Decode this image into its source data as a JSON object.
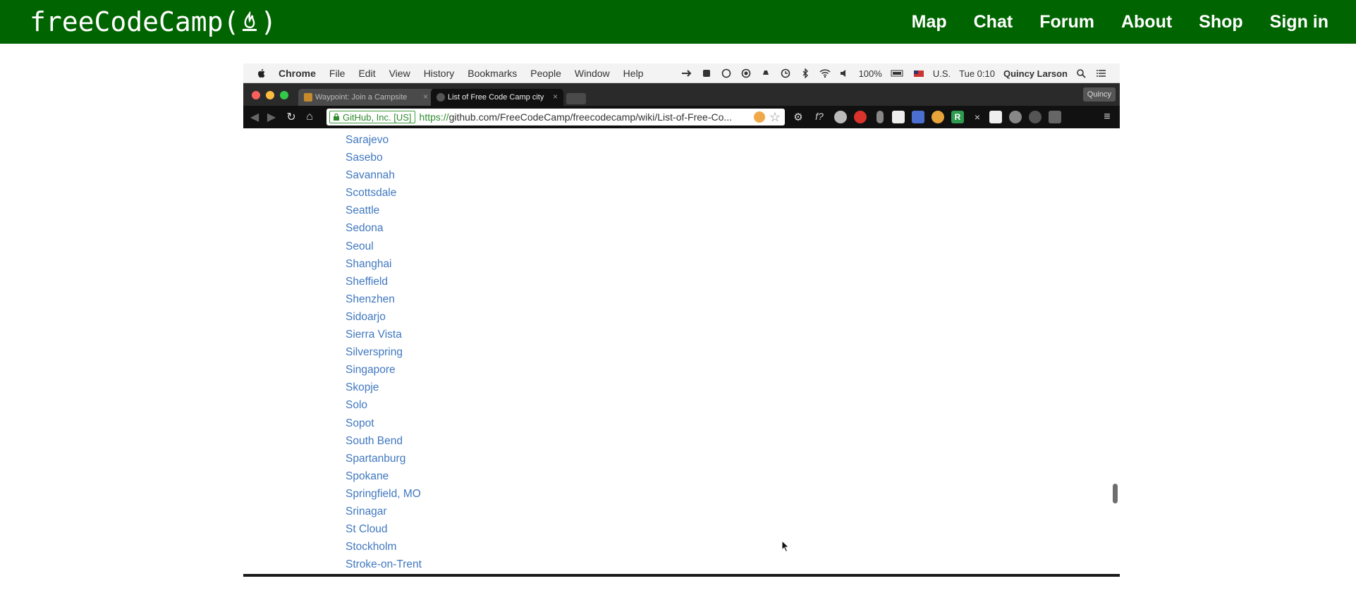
{
  "colors": {
    "fcc_green": "#006400",
    "link_blue": "#4078c0",
    "ev_green": "#2e8b2e"
  },
  "fcc": {
    "logo_left": "freeCodeCamp(",
    "logo_right": ")",
    "logo_icon": "flame-icon",
    "nav": [
      "Map",
      "Chat",
      "Forum",
      "About",
      "Shop",
      "Sign in"
    ]
  },
  "mac_menu": {
    "apple_icon": "apple-icon",
    "items": [
      "Chrome",
      "File",
      "Edit",
      "View",
      "History",
      "Bookmarks",
      "People",
      "Window",
      "Help"
    ],
    "battery": "100%",
    "input_source": "U.S.",
    "clock": "Tue 0:10",
    "user": "Quincy Larson"
  },
  "browser": {
    "tabs": [
      {
        "label": "Waypoint: Join a Campsite",
        "icon": "fcc-favicon-icon"
      },
      {
        "label": "List of Free Code Camp city",
        "icon": "github-favicon-icon"
      }
    ],
    "profile": "Quincy",
    "ev_label": "GitHub, Inc. [US]",
    "url_scheme": "https://",
    "url_rest": "github.com/FreeCodeCamp/freecodecamp/wiki/List-of-Free-Co..."
  },
  "cities": [
    "Sarajevo",
    "Sasebo",
    "Savannah",
    "Scottsdale",
    "Seattle",
    "Sedona",
    "Seoul",
    "Shanghai",
    "Sheffield",
    "Shenzhen",
    "Sidoarjo",
    "Sierra Vista",
    "Silverspring",
    "Singapore",
    "Skopje",
    "Solo",
    "Sopot",
    "South Bend",
    "Spartanburg",
    "Spokane",
    "Springfield, MO",
    "Srinagar",
    "St Cloud",
    "Stockholm",
    "Stroke-on-Trent"
  ]
}
